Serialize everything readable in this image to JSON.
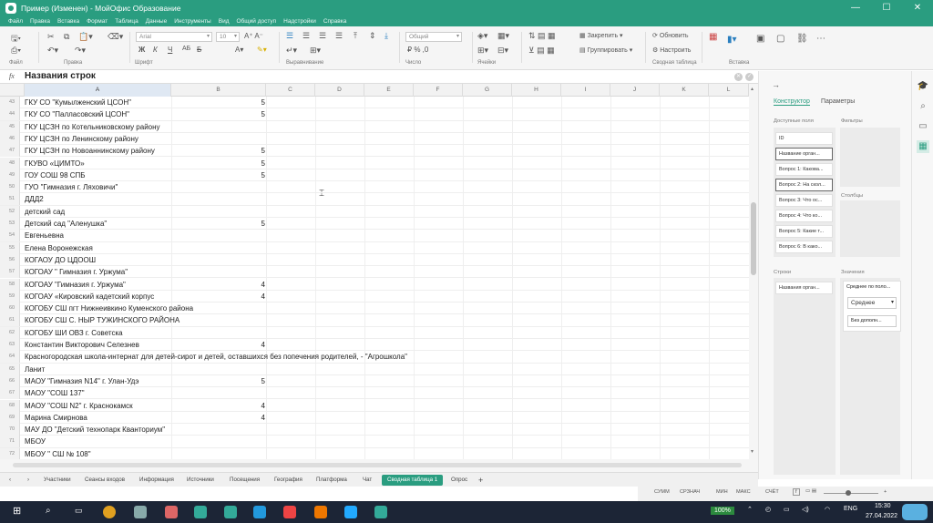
{
  "window": {
    "title": "Пример (Изменен) - МойОфис Образование",
    "min": "—",
    "max": "☐",
    "close": "✕"
  },
  "menu": [
    "Файл",
    "Правка",
    "Вставка",
    "Формат",
    "Таблица",
    "Данные",
    "Инструменты",
    "Вид",
    "Общий доступ",
    "Надстройки",
    "Справка"
  ],
  "ribbon": {
    "groups": [
      "Файл",
      "Правка",
      "Шрифт",
      "Выравнивание",
      "Число",
      "Ячейки",
      "Сводная таблица",
      "Вставка"
    ],
    "font_name": "Arial",
    "font_size": "10",
    "number_format": "Общий",
    "freeze": "Закрепить",
    "group": "Группировать",
    "refresh": "Обновить",
    "configure": "Настроить"
  },
  "formula": {
    "fx": "fx",
    "value": "Названия строк"
  },
  "columns": [
    "A",
    "B",
    "C",
    "D",
    "E",
    "F",
    "G",
    "H",
    "I",
    "J",
    "K",
    "L"
  ],
  "rows": [
    {
      "n": "43",
      "a": "ГКУ СО \"Кумылженский ЦСОН\"",
      "b": "5"
    },
    {
      "n": "44",
      "a": "ГКУ СО \"Палласовский ЦСОН\"",
      "b": "5"
    },
    {
      "n": "45",
      "a": "ГКУ ЦСЗН по Котельниковскому району",
      "b": ""
    },
    {
      "n": "46",
      "a": "ГКУ ЦСЗН по Ленинскому району",
      "b": ""
    },
    {
      "n": "47",
      "a": "ГКУ ЦСЗН по Новоаннинскому району",
      "b": "5"
    },
    {
      "n": "48",
      "a": "ГКУВО «ЦИМТО»",
      "b": "5"
    },
    {
      "n": "49",
      "a": "ГОУ СОШ 98 СПБ",
      "b": "5"
    },
    {
      "n": "50",
      "a": "ГУО \"Гимназия г. Ляховичи\"",
      "b": ""
    },
    {
      "n": "51",
      "a": "ДДД2",
      "b": ""
    },
    {
      "n": "52",
      "a": "детский сад",
      "b": ""
    },
    {
      "n": "53",
      "a": "Детский сад \"Аленушка\"",
      "b": "5"
    },
    {
      "n": "54",
      "a": "Евгеньевна",
      "b": ""
    },
    {
      "n": "55",
      "a": "Елена Воронежская",
      "b": ""
    },
    {
      "n": "56",
      "a": "КОГАОУ ДО ЦДООШ",
      "b": ""
    },
    {
      "n": "57",
      "a": "КОГОАУ \" Гимназия г. Уржума\"",
      "b": ""
    },
    {
      "n": "58",
      "a": "КОГОАУ \"Гимназия г. Уржума\"",
      "b": "4"
    },
    {
      "n": "59",
      "a": "КОГОАУ «Кировский кадетский корпус",
      "b": "4"
    },
    {
      "n": "60",
      "a": "КОГОБУ СШ пгт Нижнеивкино Куменского района",
      "b": ""
    },
    {
      "n": "61",
      "a": "КОГОБУ СШ С. НЫР ТУЖИНСКОГО РАЙОНА",
      "b": ""
    },
    {
      "n": "62",
      "a": "КОГОБУ ШИ ОВЗ г. Советска",
      "b": ""
    },
    {
      "n": "63",
      "a": "Константин Викторович Селезнев",
      "b": "4"
    },
    {
      "n": "64",
      "a": "Красногородская школа-интернат для детей-сирот и детей, оставшихся без попечения родителей, - \"Агрошкола\"",
      "b": ""
    },
    {
      "n": "65",
      "a": "Ланит",
      "b": ""
    },
    {
      "n": "66",
      "a": "МАОУ  \"Гимназия N14\"  г. Улан-Удэ",
      "b": "5"
    },
    {
      "n": "67",
      "a": "МАОУ \"СОШ 137\"",
      "b": ""
    },
    {
      "n": "68",
      "a": "МАОУ \"СОШ N2\" г. Краснокамск",
      "b": "4"
    },
    {
      "n": "69",
      "a": "Марина Смирнова",
      "b": "4"
    },
    {
      "n": "70",
      "a": "МАУ ДО \"Детский технопарк Кванториум\"",
      "b": ""
    },
    {
      "n": "71",
      "a": "МБОУ",
      "b": ""
    },
    {
      "n": "72",
      "a": "МБОУ \" СШ № 108\"",
      "b": ""
    }
  ],
  "panel": {
    "tabs": [
      "Конструктор",
      "Параметры"
    ],
    "available": "Доступные поля",
    "filters": "Фильтры",
    "columns": "Столбцы",
    "rows_lbl": "Строки",
    "values_lbl": "Значения",
    "fields": [
      "ID",
      "Название орган...",
      "Вопрос 1: Какова...",
      "Вопрос 2: На скол...",
      "Вопрос 3: Что ос...",
      "Вопрос 4: Что ко...",
      "Вопрос 5: Какие т...",
      "Вопрос 6: В како..."
    ],
    "row_field": "Названия орган...",
    "value_field": "Среднее по поло...",
    "agg": "Среднее",
    "extra": "Без дополн..."
  },
  "sheets": [
    "Участники",
    "Сеансы входов",
    "Информация",
    "Источники",
    "Посещения",
    "География",
    "Платформа",
    "Чат",
    "Сводная таблица 1",
    "Опрос"
  ],
  "active_sheet": "Сводная таблица 1",
  "status": [
    "СУММ",
    "СРЗНАЧ",
    "МИН",
    "МАКС",
    "СЧЁТ"
  ],
  "clock": {
    "time": "15:30",
    "date": "27.04.2022"
  },
  "tray": {
    "battery": "100%",
    "lang": "ENG"
  }
}
